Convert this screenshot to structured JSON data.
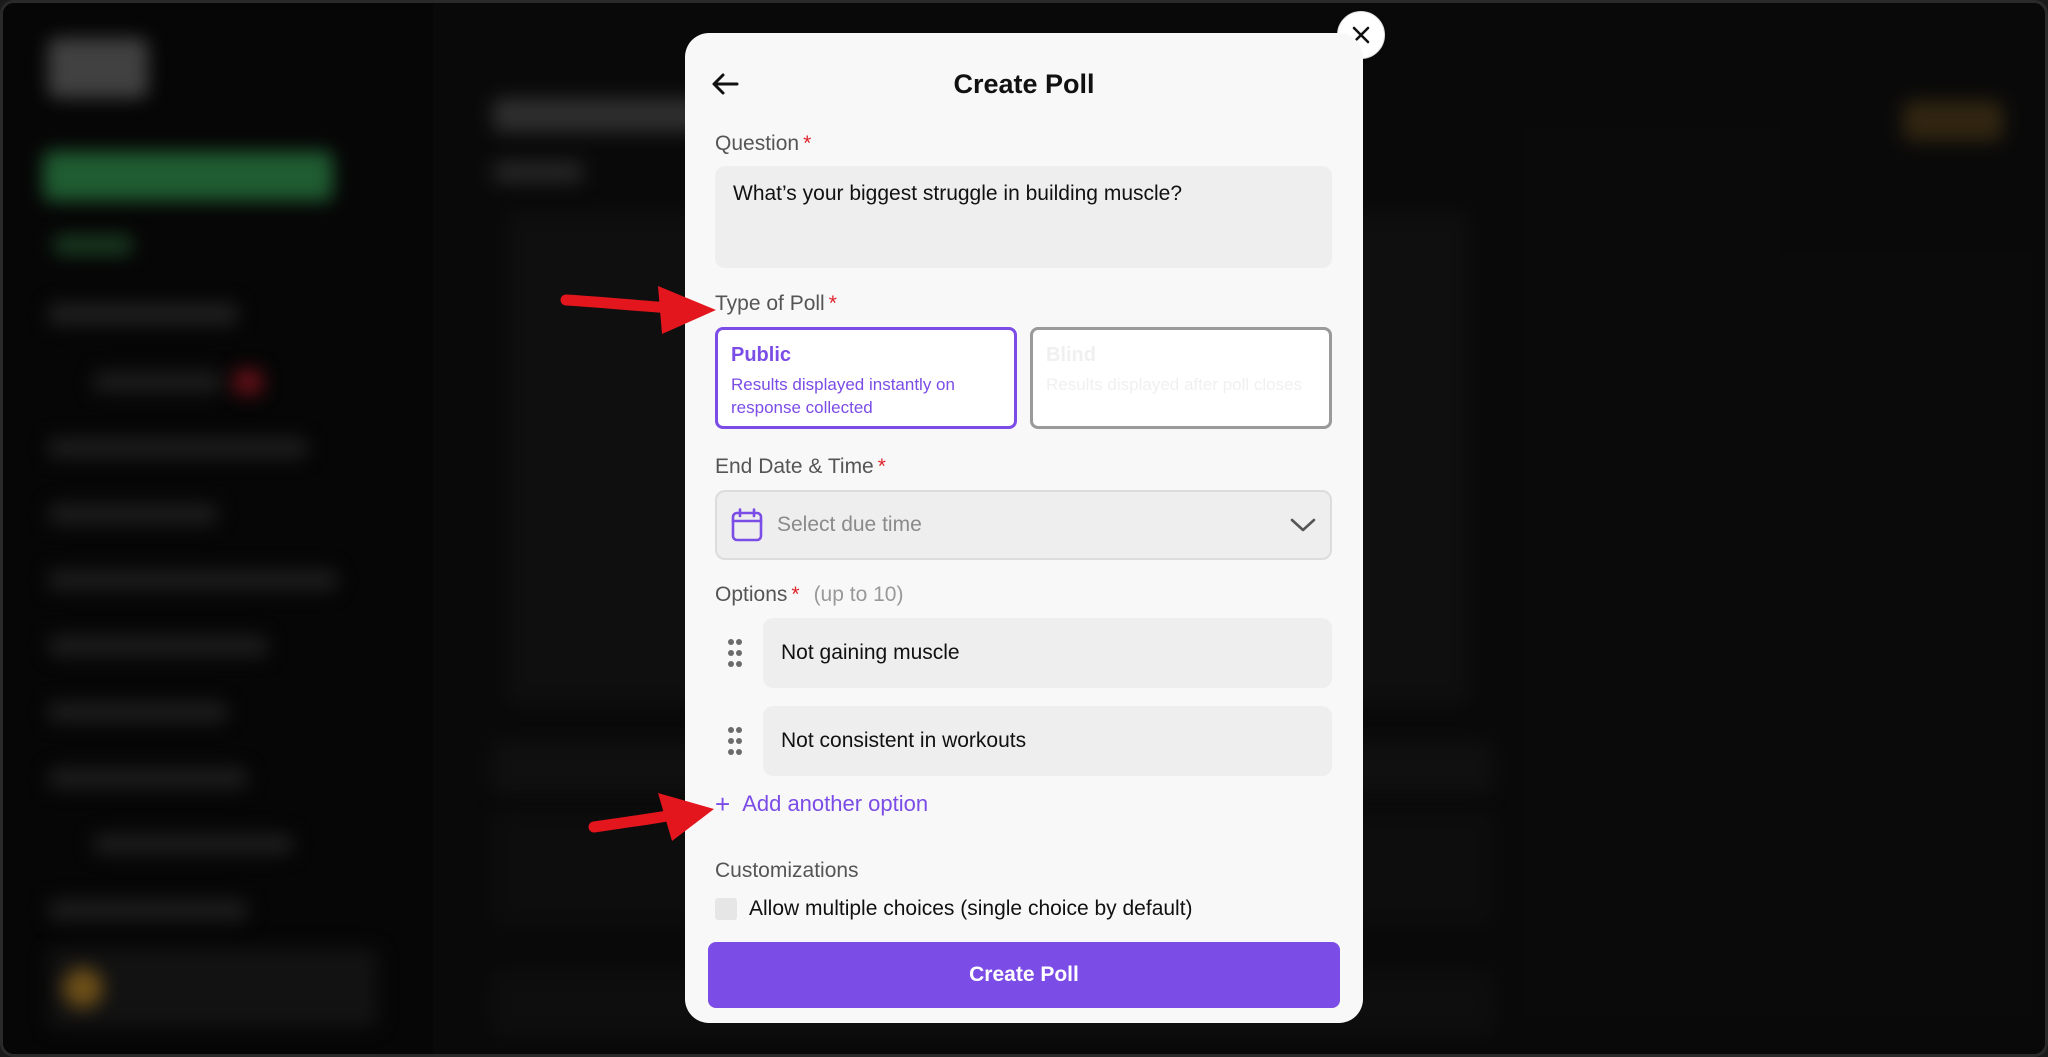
{
  "modal": {
    "title": "Create Poll",
    "question": {
      "label": "Question",
      "required_mark": "*",
      "value": "What’s your biggest struggle in building muscle?"
    },
    "poll_type": {
      "label": "Type of Poll",
      "required_mark": "*",
      "options": [
        {
          "title": "Public",
          "description": "Results displayed instantly on response collected",
          "selected": true
        },
        {
          "title": "Blind",
          "description": "Results displayed after poll closes",
          "selected": false
        }
      ]
    },
    "end_date": {
      "label": "End Date & Time",
      "required_mark": "*",
      "placeholder": "Select due time"
    },
    "options": {
      "label": "Options",
      "required_mark": "*",
      "hint": "(up to 10)",
      "items": [
        "Not gaining muscle",
        "Not consistent in workouts"
      ],
      "add_label": "Add another option",
      "add_icon": "+"
    },
    "customizations": {
      "label": "Customizations",
      "multiple_choices_label": "Allow multiple choices (single choice by default)"
    },
    "submit_label": "Create Poll"
  },
  "colors": {
    "accent": "#7b4ce6",
    "required": "#e0242b",
    "annotation_arrow": "#e3161e"
  },
  "icons": {
    "close": "close-icon",
    "back": "arrow-left-icon",
    "calendar": "calendar-icon",
    "chevron": "chevron-down-icon",
    "drag": "drag-handle-icon"
  }
}
